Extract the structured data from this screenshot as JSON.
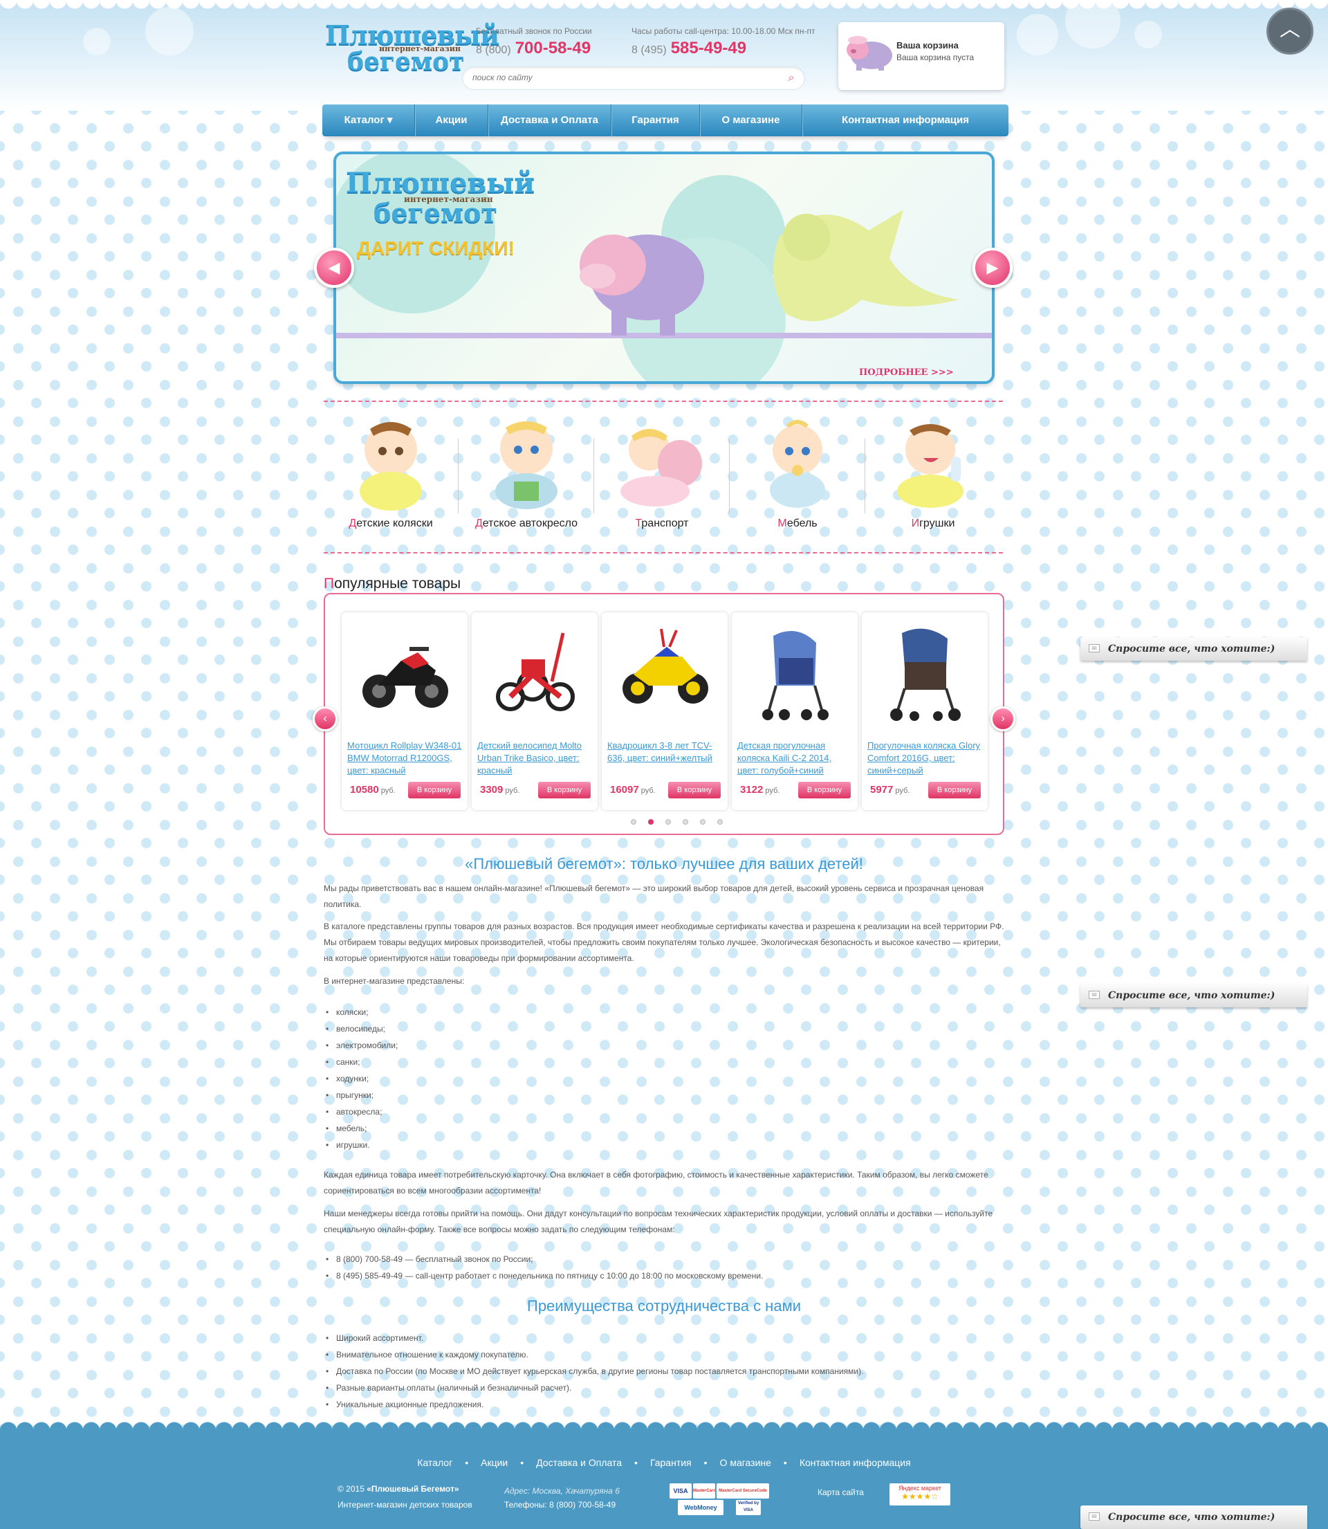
{
  "header": {
    "logo_line1": "Плюшевый",
    "logo_sub": "интернет-магазин",
    "logo_line2": "бегемот",
    "phone_free_caption": "Бесплатный звонок по России",
    "phone_free_prefix": "8 (800)",
    "phone_free_number": "700-58-49",
    "phone_hours_caption": "Часы работы call-центра: 10.00-18.00 Мск пн-пт",
    "phone_hours_prefix": "8 (495)",
    "phone_hours_number": "585-49-49",
    "search_placeholder": "поиск по сайту",
    "cart_title": "Ваша корзина",
    "cart_status": "Ваша корзина пуста"
  },
  "nav": {
    "items": [
      {
        "label": "Каталог ▾"
      },
      {
        "label": "Акции"
      },
      {
        "label": "Доставка и Оплата"
      },
      {
        "label": "Гарантия"
      },
      {
        "label": "О магазине"
      },
      {
        "label": "Контактная информация"
      }
    ]
  },
  "banner": {
    "logo_line1": "Плюшевый",
    "logo_sub": "интернет-магазин",
    "logo_line2": "бегемот",
    "headline": "ДАРИТ СКИДКИ!",
    "more_link": "ПОДРОБНЕЕ >>>"
  },
  "categories": [
    {
      "first": "Д",
      "rest": "етские коляски"
    },
    {
      "first": "Д",
      "rest": "етское автокресло"
    },
    {
      "first": "Т",
      "rest": "ранспорт"
    },
    {
      "first": "М",
      "rest": "ебель"
    },
    {
      "first": "И",
      "rest": "грушки"
    }
  ],
  "popular": {
    "title_first": "П",
    "title_rest": "опулярные товары",
    "currency": "руб.",
    "cart_button": "В корзину",
    "products": [
      {
        "name": "Мотоцикл Rollplay W348-01 BMW Motorrad R1200GS, цвет: красный",
        "price": "10580"
      },
      {
        "name": "Детский велосипед Molto Urban Trike Basico, цвет: красный",
        "price": "3309"
      },
      {
        "name": "Квадроцикл 3-8 лет TCV-636, цвет: синий+желтый",
        "price": "16097"
      },
      {
        "name": "Детская прогулочная коляска Kaili C-2 2014, цвет: голубой+синий",
        "price": "3122"
      },
      {
        "name": "Прогулочная коляска Glory Comfort 2016G, цвет: синий+серый",
        "price": "5977"
      }
    ],
    "pages": 6,
    "active_page": 2
  },
  "content": {
    "heading": "«Плюшевый бегемот»: только лучшее для ваших детей!",
    "p1": "Мы рады приветствовать вас в нашем онлайн-магазине! «Плюшевый бегемот» — это широкий выбор товаров для детей, высокий уровень сервиса и прозрачная ценовая политика.",
    "p2": "В каталоге представлены группы товаров для разных возрастов. Вся продукция имеет необходимые сертификаты качества и разрешена к реализации на всей территории РФ. Мы отбираем товары ведущих мировых производителей, чтобы предложить своим покупателям только лучшее. Экологическая безопасность и высокое качество — критерии, на которые ориентируются наши товароведы при формировании ассортимента.",
    "p3": "В интернет-магазине представлены:",
    "items": [
      "коляски;",
      "велосипеды;",
      "электромобили;",
      "санки;",
      "ходунки;",
      "прыгунки;",
      "автокресла;",
      "мебель;",
      "игрушки."
    ],
    "p4": "Каждая единица товара имеет потребительскую карточку. Она включает в себя фотографию, стоимость и качественные характеристики. Таким образом, вы легко сможете сориентироваться во всем многообразии ассортимента!",
    "p5": "Наши менеджеры всегда готовы прийти на помощь. Они дадут консультации по вопросам технических характеристик продукции, условий оплаты и доставки — используйте специальную онлайн-форму. Также все вопросы можно задать по следующим телефонам:",
    "phones": [
      "8 (800) 700-58-49 — бесплатный звонок по России;",
      "8 (495) 585-49-49 — call-центр работает с понедельника по пятницу с 10:00 до 18:00 по московскому времени."
    ],
    "heading2": "Преимущества сотрудничества с нами",
    "advantages": [
      "Широкий ассортимент.",
      "Внимательное отношение к каждому покупателю.",
      "Доставка по России (по Москве и МО действует курьерская служба, в другие регионы товар поставляется транспортными компаниями).",
      "Разные варианты оплаты (наличный и безналичный расчет).",
      "Уникальные акционные предложения."
    ]
  },
  "ask_widget": {
    "label": "Спросите все, что хотите:)"
  },
  "footer": {
    "nav": [
      "Каталог",
      "Акции",
      "Доставка и Оплата",
      "Гарантия",
      "О магазине",
      "Контактная информация"
    ],
    "copyright_year": "© 2015",
    "copyright_name": "«Плюшевый Бегемот»",
    "tagline": "Интернет-магазин детских товаров",
    "address": "Адрес: Москва, Хачатуряна 6",
    "phones": "Телефоны: 8 (800) 700-58-49",
    "sitemap": "Карта сайта",
    "payments": [
      "VISA",
      "MasterCard",
      "MasterCard SecureCode",
      "WebMoney",
      "Verified by VISA"
    ],
    "market_label": "Яндекс маркет",
    "market_stars": "★★★★☆"
  },
  "colors": {
    "accent_pink": "#e03565",
    "accent_blue": "#3a9ad8",
    "nav_blue": "#2a87bd",
    "footer_blue": "#4c9ac4"
  },
  "icons": [
    "search-icon",
    "chevron-up-icon",
    "arrow-left-icon",
    "arrow-right-icon",
    "envelope-icon",
    "hippo-icon"
  ]
}
